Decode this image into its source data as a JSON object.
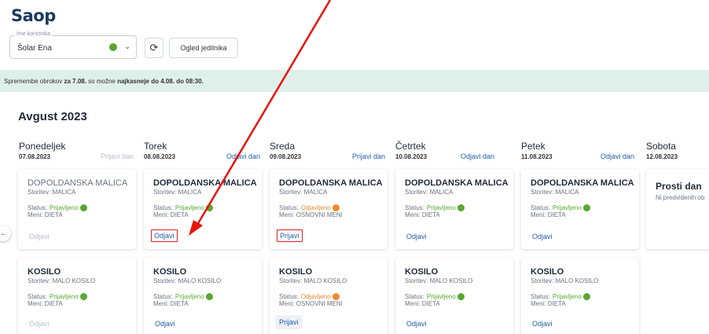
{
  "app": {
    "logo": "Saop"
  },
  "user_select": {
    "label": "Ime koristnika",
    "value": "Šolar Ena"
  },
  "toolbar": {
    "menu_button": "Ogled jedilnika"
  },
  "notice": {
    "prefix": "Spremembe obrokov ",
    "date": "za 7.08.",
    "middle": " so možne ",
    "deadline": "najkasneje do 4.08. do 08:30."
  },
  "calendar": {
    "month": "Avgust 2023",
    "days": [
      {
        "name": "Ponedeljek",
        "date": "07.08.2023",
        "action": "Prijavi dan"
      },
      {
        "name": "Torek",
        "date": "08.08.2023",
        "action": "Odjavi dan"
      },
      {
        "name": "Sreda",
        "date": "09.08.2023",
        "action": "Prijavi dan"
      },
      {
        "name": "Četrtek",
        "date": "10.08.2023",
        "action": "Odjavi dan"
      },
      {
        "name": "Petek",
        "date": "11.08.2023",
        "action": "Odjavi dan"
      },
      {
        "name": "Sobota",
        "date": "12.08.2023",
        "action": ""
      }
    ],
    "malica": [
      {
        "title": "DOPOLDANSKA MALICA",
        "service": "Storitev: MALICA",
        "status_label": "Status:",
        "status": "Prijavljeno",
        "menu": "Meni: DIETA",
        "action": "Odjavi"
      },
      {
        "title": "DOPOLDANSKA MALICA",
        "service": "Storitev: MALICA",
        "status_label": "Status:",
        "status": "Prijavljeno",
        "menu": "Meni: DIETA",
        "action": "Odjavi"
      },
      {
        "title": "DOPOLDANSKA MALICA",
        "service": "Storitev: MALICA",
        "status_label": "Status:",
        "status": "Odjavljeno",
        "menu": "Meni: OSNOVNI MENI",
        "action": "Prijavi"
      },
      {
        "title": "DOPOLDANSKA MALICA",
        "service": "Storitev: MALICA",
        "status_label": "Status:",
        "status": "Prijavljeno",
        "menu": "Meni: DIETA",
        "action": "Odjavi"
      },
      {
        "title": "DOPOLDANSKA MALICA",
        "service": "Storitev: MALICA",
        "status_label": "Status:",
        "status": "Prijavljeno",
        "menu": "Meni: DIETA",
        "action": "Odjavi"
      }
    ],
    "kosilo": [
      {
        "title": "KOSILO",
        "service": "Storitev: MALO KOSILO",
        "status_label": "Status:",
        "status": "Prijavljeno",
        "menu": "Meni: DIETA",
        "action": "Odjavi"
      },
      {
        "title": "KOSILO",
        "service": "Storitev: MALO KOSILO",
        "status_label": "Status:",
        "status": "Prijavljeno",
        "menu": "Meni: DIETA",
        "action": "Odjavi"
      },
      {
        "title": "KOSILO",
        "service": "Storitev: MALO KOSILO",
        "status_label": "Status:",
        "status": "Odjavljeno",
        "menu": "Meni: OSNOVNI MENI",
        "action": "Prijavi"
      },
      {
        "title": "KOSILO",
        "service": "Storitev: MALO KOSILO",
        "status_label": "Status:",
        "status": "Prijavljeno",
        "menu": "Meni: DIETA",
        "action": "Odjavi"
      },
      {
        "title": "KOSILO",
        "service": "Storitev: MALO KOSILO",
        "status_label": "Status:",
        "status": "Prijavljeno",
        "menu": "Meni: DIETA",
        "action": "Odjavi"
      }
    ],
    "holiday": {
      "title": "Prosti dan",
      "subtitle": "Ni predvidenih ob"
    }
  },
  "colors": {
    "brand": "#1c3a5e",
    "link": "#1f5fa8",
    "ok": "#58a82f",
    "cancelled": "#f08a2a",
    "notice_bg": "#dff0ea",
    "highlight": "#e02020"
  }
}
